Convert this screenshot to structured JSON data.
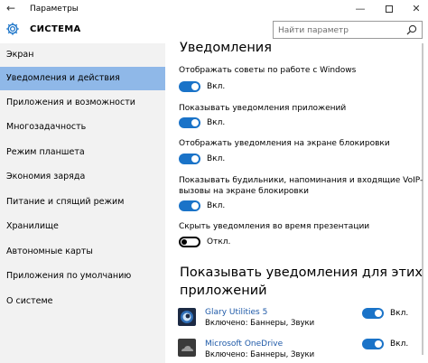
{
  "window": {
    "title": "Параметры",
    "back_glyph": "←",
    "minimize_glyph": "—",
    "close_glyph": "✕"
  },
  "header": {
    "title": "СИСТЕМА",
    "search_placeholder": "Найти параметр"
  },
  "sidebar": {
    "items": [
      {
        "label": "Экран",
        "active": false
      },
      {
        "label": "Уведомления и действия",
        "active": true
      },
      {
        "label": "Приложения и возможности",
        "active": false
      },
      {
        "label": "Многозадачность",
        "active": false
      },
      {
        "label": "Режим планшета",
        "active": false
      },
      {
        "label": "Экономия заряда",
        "active": false
      },
      {
        "label": "Питание и спящий режим",
        "active": false
      },
      {
        "label": "Хранилище",
        "active": false
      },
      {
        "label": "Автономные карты",
        "active": false
      },
      {
        "label": "Приложения по умолчанию",
        "active": false
      },
      {
        "label": "О системе",
        "active": false
      }
    ]
  },
  "main": {
    "notifications_heading": "Уведомления",
    "settings": [
      {
        "label": "Отображать советы по работе с Windows",
        "state": "Вкл."
      },
      {
        "label": "Показывать уведомления приложений",
        "state": "Вкл."
      },
      {
        "label": "Отображать уведомления на экране блокировки",
        "state": "Вкл."
      },
      {
        "label_line1": "Показывать будильники, напоминания и входящие VoIP-",
        "label_line2": "вызовы на экране блокировки",
        "state": "Вкл."
      },
      {
        "label": "Скрыть уведомления во время презентации",
        "state": "Откл."
      }
    ],
    "apps_heading_line1": "Показывать уведомления для этих",
    "apps_heading_line2": "приложений",
    "apps": [
      {
        "name": "Glary Utilities 5",
        "status": "Включено: Баннеры, Звуки",
        "state": "Вкл."
      },
      {
        "name": "Microsoft OneDrive",
        "status": "Включено: Баннеры, Звуки",
        "state": "Вкл."
      }
    ]
  },
  "colors": {
    "accent": "#1a73c8",
    "sidebar_bg": "#f2f2f2",
    "active_item_bg": "#8fb8e8",
    "link": "#1f5aa8"
  }
}
